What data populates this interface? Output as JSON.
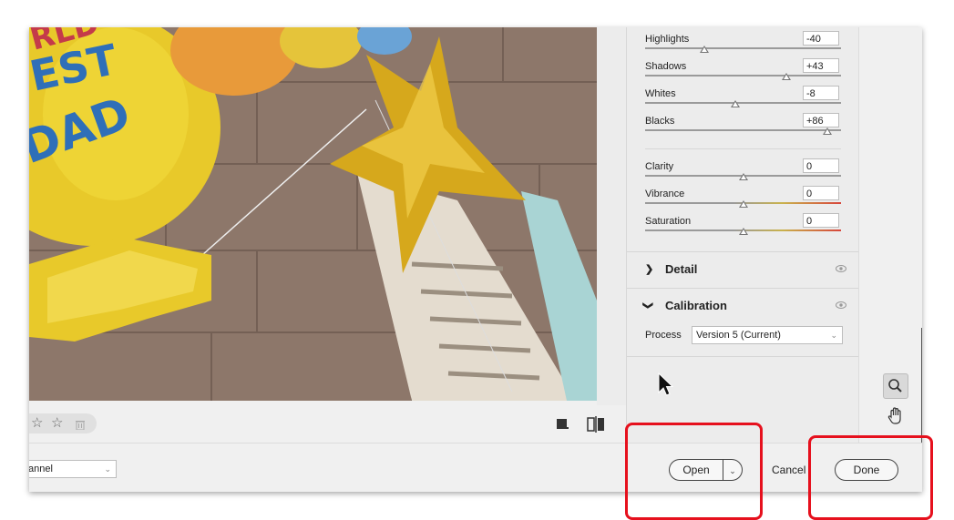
{
  "basic_sliders": [
    {
      "label": "Highlights",
      "value": "-40",
      "position": 0.3
    },
    {
      "label": "Shadows",
      "value": "+43",
      "position": 0.72
    },
    {
      "label": "Whites",
      "value": "-8",
      "position": 0.46
    },
    {
      "label": "Blacks",
      "value": "+86",
      "position": 0.93
    }
  ],
  "presence_sliders": [
    {
      "label": "Clarity",
      "value": "0",
      "position": 0.5,
      "track": "gray"
    },
    {
      "label": "Vibrance",
      "value": "0",
      "position": 0.5,
      "track": "color"
    },
    {
      "label": "Saturation",
      "value": "0",
      "position": 0.5,
      "track": "color"
    }
  ],
  "sections": {
    "detail": {
      "title": "Detail",
      "chevron": "chevron-right-icon"
    },
    "calibration": {
      "title": "Calibration",
      "chevron": "chevron-down-icon"
    }
  },
  "calibration": {
    "process_label": "Process",
    "process_value": "Version 5 (Current)"
  },
  "footer": {
    "channel_value": "annel",
    "open_label": "Open",
    "cancel_label": "Cancel",
    "done_label": "Done"
  },
  "rating": {
    "stars": [
      "☆",
      "☆"
    ]
  },
  "colors": {
    "highlight": "#e6101d",
    "panel": "#ececec"
  }
}
